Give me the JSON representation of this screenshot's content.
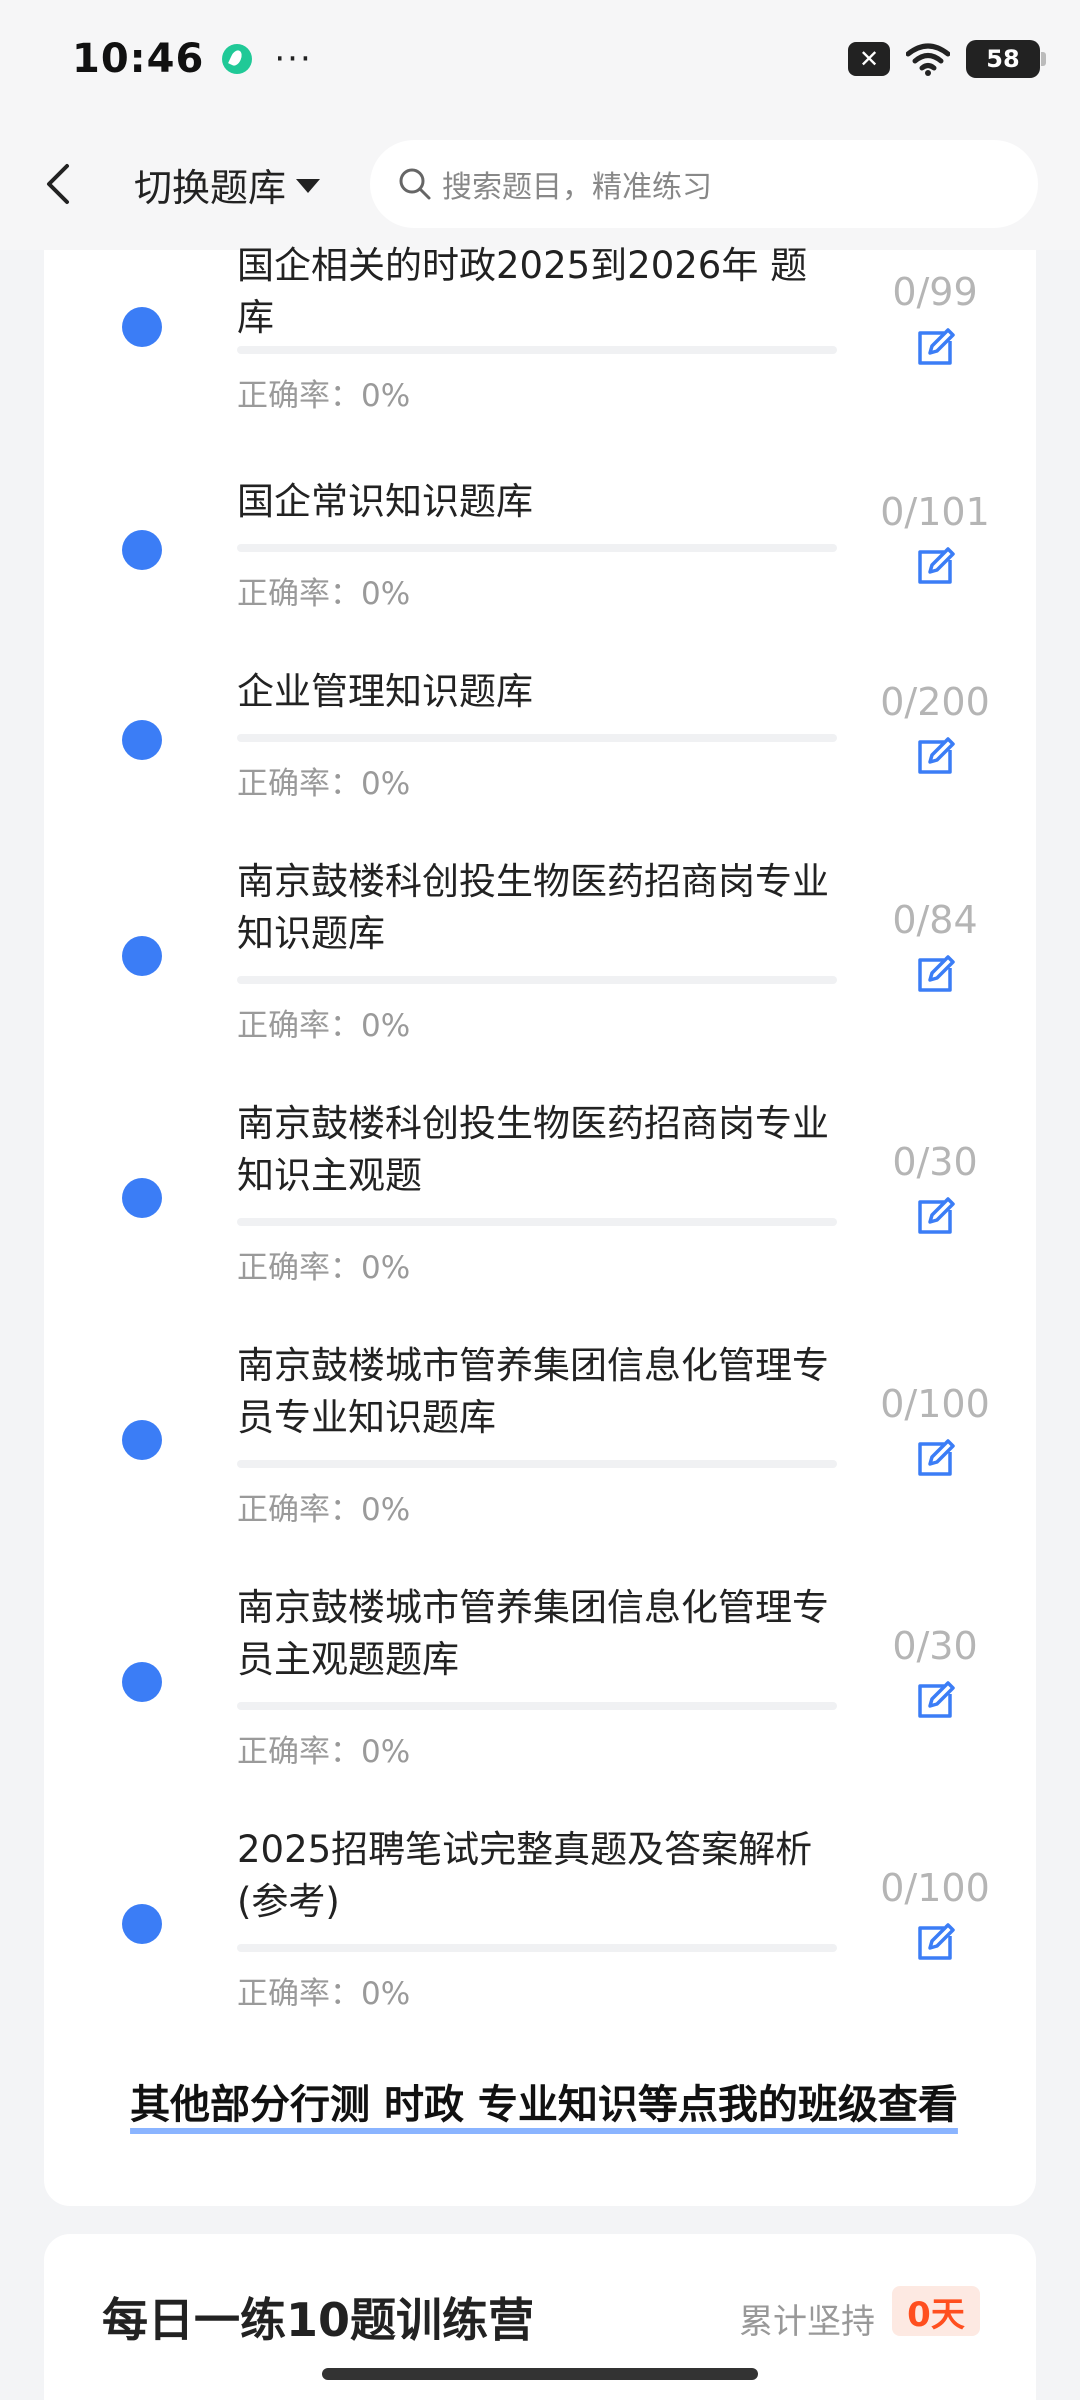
{
  "status_bar": {
    "time": "10:46",
    "dots": "···",
    "battery": "58"
  },
  "header": {
    "switch_label": "切换题库",
    "search_placeholder": "搜索题目，精准练习"
  },
  "list": {
    "items": [
      {
        "title": "国企相关的时政2025到2026年 题库",
        "accuracy": "正确率：0%",
        "count": "0/99",
        "progress": 0
      },
      {
        "title": "国企常识知识题库",
        "accuracy": "正确率：0%",
        "count": "0/101",
        "progress": 0
      },
      {
        "title": "企业管理知识题库",
        "accuracy": "正确率：0%",
        "count": "0/200",
        "progress": 0
      },
      {
        "title": "南京鼓楼科创投生物医药招商岗专业知识题库",
        "accuracy": "正确率：0%",
        "count": "0/84",
        "progress": 0
      },
      {
        "title": "南京鼓楼科创投生物医药招商岗专业知识主观题",
        "accuracy": "正确率：0%",
        "count": "0/30",
        "progress": 0
      },
      {
        "title": "南京鼓楼城市管养集团信息化管理专员专业知识题库",
        "accuracy": "正确率：0%",
        "count": "0/100",
        "progress": 0
      },
      {
        "title": "南京鼓楼城市管养集团信息化管理专员主观题题库",
        "accuracy": "正确率：0%",
        "count": "0/30",
        "progress": 0
      },
      {
        "title": "2025招聘笔试完整真题及答案解析(参考)",
        "accuracy": "正确率：0%",
        "count": "0/100",
        "progress": 0
      }
    ],
    "more_link": "其他部分行测 时政 专业知识等点我的班级查看"
  },
  "camp": {
    "title": "每日一练10题训练营",
    "streak_label": "累计坚持",
    "streak_value": "0天"
  },
  "colors": {
    "accent": "#3b7df6",
    "streak": "#ff4f1f"
  }
}
